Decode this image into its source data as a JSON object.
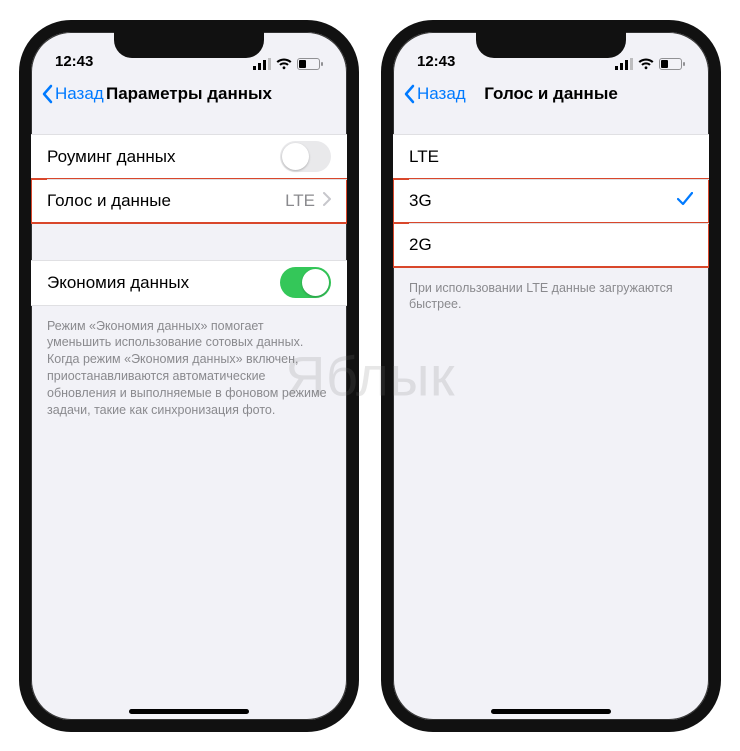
{
  "watermark": "Яблык",
  "status": {
    "time": "12:43"
  },
  "left": {
    "back": "Назад",
    "title": "Параметры данных",
    "roaming_label": "Роуминг данных",
    "voice_data_label": "Голос и данные",
    "voice_data_value": "LTE",
    "low_data_label": "Экономия данных",
    "low_data_note": "Режим «Экономия данных» помогает уменьшить использование сотовых данных. Когда режим «Экономия данных» включен, приостанавливаются автоматические обновления и выполняемые в фоновом режиме задачи, такие как синхронизация фото."
  },
  "right": {
    "back": "Назад",
    "title": "Голос и данные",
    "options": [
      "LTE",
      "3G",
      "2G"
    ],
    "selected": "3G",
    "footer": "При использовании LTE данные загружаются быстрее."
  }
}
